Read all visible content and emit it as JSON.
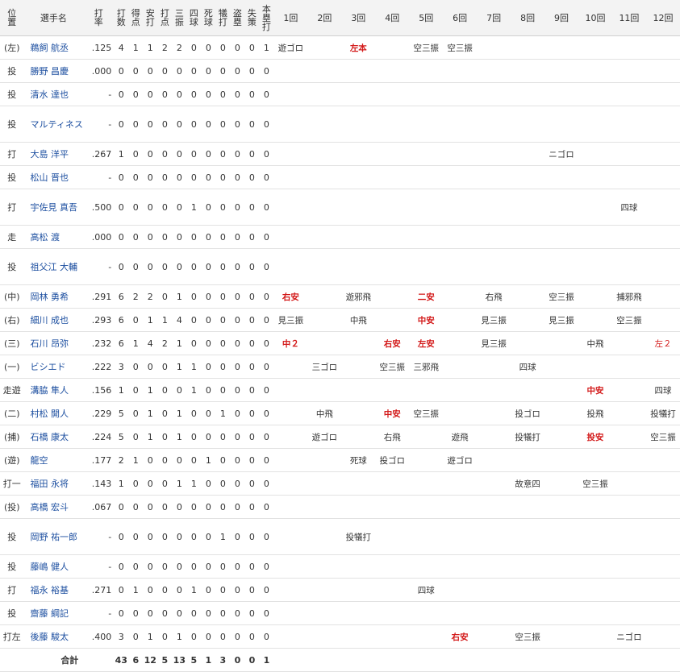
{
  "headers": {
    "pos": [
      "位",
      "置"
    ],
    "name": "選手名",
    "stats": [
      [
        "打",
        "率"
      ],
      [
        "打",
        "数"
      ],
      [
        "得",
        "点"
      ],
      [
        "安",
        "打"
      ],
      [
        "打",
        "点"
      ],
      [
        "三",
        "振"
      ],
      [
        "四",
        "球"
      ],
      [
        "死",
        "球"
      ],
      [
        "犠",
        "打"
      ],
      [
        "盗",
        "塁"
      ],
      [
        "失",
        "策"
      ],
      [
        "本",
        "塁",
        "打"
      ]
    ],
    "innings": [
      "1回",
      "2回",
      "3回",
      "4回",
      "5回",
      "6回",
      "7回",
      "8回",
      "9回",
      "10回",
      "11回",
      "12回"
    ]
  },
  "rows": [
    {
      "pos": "(左)",
      "name": "鵜飼 航丞",
      "avg": ".125",
      "s": [
        "4",
        "1",
        "1",
        "2",
        "2",
        "0",
        "0",
        "0",
        "0",
        "0",
        "1"
      ],
      "inn": [
        "遊ゴロ",
        "",
        "左本",
        "",
        "空三振",
        "空三振",
        "",
        "",
        "",
        "",
        "",
        ""
      ],
      "tall": false
    },
    {
      "pos": "投",
      "name": "勝野 昌慶",
      "avg": ".000",
      "s": [
        "0",
        "0",
        "0",
        "0",
        "0",
        "0",
        "0",
        "0",
        "0",
        "0",
        "0"
      ],
      "inn": [
        "",
        "",
        "",
        "",
        "",
        "",
        "",
        "",
        "",
        "",
        "",
        ""
      ],
      "tall": false
    },
    {
      "pos": "投",
      "name": "清水 達也",
      "avg": "-",
      "s": [
        "0",
        "0",
        "0",
        "0",
        "0",
        "0",
        "0",
        "0",
        "0",
        "0",
        "0"
      ],
      "inn": [
        "",
        "",
        "",
        "",
        "",
        "",
        "",
        "",
        "",
        "",
        "",
        ""
      ],
      "tall": false
    },
    {
      "pos": "投",
      "name": "マルティネス",
      "avg": "-",
      "s": [
        "0",
        "0",
        "0",
        "0",
        "0",
        "0",
        "0",
        "0",
        "0",
        "0",
        "0"
      ],
      "inn": [
        "",
        "",
        "",
        "",
        "",
        "",
        "",
        "",
        "",
        "",
        "",
        ""
      ],
      "tall": true
    },
    {
      "pos": "打",
      "name": "大島 洋平",
      "avg": ".267",
      "s": [
        "1",
        "0",
        "0",
        "0",
        "0",
        "0",
        "0",
        "0",
        "0",
        "0",
        "0"
      ],
      "inn": [
        "",
        "",
        "",
        "",
        "",
        "",
        "",
        "",
        "ニゴロ",
        "",
        "",
        ""
      ],
      "tall": false
    },
    {
      "pos": "投",
      "name": "松山 晋也",
      "avg": "-",
      "s": [
        "0",
        "0",
        "0",
        "0",
        "0",
        "0",
        "0",
        "0",
        "0",
        "0",
        "0"
      ],
      "inn": [
        "",
        "",
        "",
        "",
        "",
        "",
        "",
        "",
        "",
        "",
        "",
        ""
      ],
      "tall": false
    },
    {
      "pos": "打",
      "name": "宇佐見 真吾",
      "avg": ".500",
      "s": [
        "0",
        "0",
        "0",
        "0",
        "0",
        "1",
        "0",
        "0",
        "0",
        "0",
        "0"
      ],
      "inn": [
        "",
        "",
        "",
        "",
        "",
        "",
        "",
        "",
        "",
        "",
        "四球",
        ""
      ],
      "tall": true
    },
    {
      "pos": "走",
      "name": "高松 渡",
      "avg": ".000",
      "s": [
        "0",
        "0",
        "0",
        "0",
        "0",
        "0",
        "0",
        "0",
        "0",
        "0",
        "0"
      ],
      "inn": [
        "",
        "",
        "",
        "",
        "",
        "",
        "",
        "",
        "",
        "",
        "",
        ""
      ],
      "tall": false
    },
    {
      "pos": "投",
      "name": "祖父江 大輔",
      "avg": "-",
      "s": [
        "0",
        "0",
        "0",
        "0",
        "0",
        "0",
        "0",
        "0",
        "0",
        "0",
        "0"
      ],
      "inn": [
        "",
        "",
        "",
        "",
        "",
        "",
        "",
        "",
        "",
        "",
        "",
        ""
      ],
      "tall": true
    },
    {
      "pos": "(中)",
      "name": "岡林 勇希",
      "avg": ".291",
      "s": [
        "6",
        "2",
        "2",
        "0",
        "1",
        "0",
        "0",
        "0",
        "0",
        "0",
        "0"
      ],
      "inn": [
        "右安",
        "",
        "遊邪飛",
        "",
        "二安",
        "",
        "右飛",
        "",
        "空三振",
        "",
        "捕邪飛",
        ""
      ],
      "tall": false
    },
    {
      "pos": "(右)",
      "name": "細川 成也",
      "avg": ".293",
      "s": [
        "6",
        "0",
        "1",
        "1",
        "4",
        "0",
        "0",
        "0",
        "0",
        "0",
        "0"
      ],
      "inn": [
        "見三振",
        "",
        "中飛",
        "",
        "中安",
        "",
        "見三振",
        "",
        "見三振",
        "",
        "空三振",
        ""
      ],
      "tall": false
    },
    {
      "pos": "(三)",
      "name": "石川 昂弥",
      "avg": ".232",
      "s": [
        "6",
        "1",
        "4",
        "2",
        "1",
        "0",
        "0",
        "0",
        "0",
        "0",
        "0"
      ],
      "inn": [
        "中２",
        "",
        "",
        "右安",
        "左安",
        "",
        "見三振",
        "",
        "",
        "中飛",
        "",
        "左２"
      ],
      "tall": false
    },
    {
      "pos": "(一)",
      "name": "ビシエド",
      "avg": ".222",
      "s": [
        "3",
        "0",
        "0",
        "0",
        "1",
        "1",
        "0",
        "0",
        "0",
        "0",
        "0"
      ],
      "inn": [
        "",
        "三ゴロ",
        "",
        "空三振",
        "三邪飛",
        "",
        "",
        "四球",
        "",
        "",
        "",
        ""
      ],
      "tall": false
    },
    {
      "pos": "走遊",
      "name": "溝脇 隼人",
      "avg": ".156",
      "s": [
        "1",
        "0",
        "1",
        "0",
        "0",
        "1",
        "0",
        "0",
        "0",
        "0",
        "0"
      ],
      "inn": [
        "",
        "",
        "",
        "",
        "",
        "",
        "",
        "",
        "",
        "中安",
        "",
        "四球"
      ],
      "tall": false
    },
    {
      "pos": "(二)",
      "name": "村松 開人",
      "avg": ".229",
      "s": [
        "5",
        "0",
        "1",
        "0",
        "1",
        "0",
        "0",
        "1",
        "0",
        "0",
        "0"
      ],
      "inn": [
        "",
        "中飛",
        "",
        "中安",
        "空三振",
        "",
        "",
        "投ゴロ",
        "",
        "投飛",
        "",
        "投犠打"
      ],
      "tall": false
    },
    {
      "pos": "(捕)",
      "name": "石橋 康太",
      "avg": ".224",
      "s": [
        "5",
        "0",
        "1",
        "0",
        "1",
        "0",
        "0",
        "0",
        "0",
        "0",
        "0"
      ],
      "inn": [
        "",
        "遊ゴロ",
        "",
        "右飛",
        "",
        "遊飛",
        "",
        "投犠打",
        "",
        "投安",
        "",
        "空三振"
      ],
      "tall": false
    },
    {
      "pos": "(遊)",
      "name": "龍空",
      "avg": ".177",
      "s": [
        "2",
        "1",
        "0",
        "0",
        "0",
        "0",
        "1",
        "0",
        "0",
        "0",
        "0"
      ],
      "inn": [
        "",
        "",
        "死球",
        "投ゴロ",
        "",
        "遊ゴロ",
        "",
        "",
        "",
        "",
        "",
        ""
      ],
      "tall": false
    },
    {
      "pos": "打一",
      "name": "福田 永将",
      "avg": ".143",
      "s": [
        "1",
        "0",
        "0",
        "0",
        "1",
        "1",
        "0",
        "0",
        "0",
        "0",
        "0"
      ],
      "inn": [
        "",
        "",
        "",
        "",
        "",
        "",
        "",
        "故意四",
        "",
        "空三振",
        "",
        ""
      ],
      "tall": false
    },
    {
      "pos": "(投)",
      "name": "高橋 宏斗",
      "avg": ".067",
      "s": [
        "0",
        "0",
        "0",
        "0",
        "0",
        "0",
        "0",
        "0",
        "0",
        "0",
        "0"
      ],
      "inn": [
        "",
        "",
        "",
        "",
        "",
        "",
        "",
        "",
        "",
        "",
        "",
        ""
      ],
      "tall": false
    },
    {
      "pos": "投",
      "name": "岡野 祐一郎",
      "avg": "-",
      "s": [
        "0",
        "0",
        "0",
        "0",
        "0",
        "0",
        "0",
        "1",
        "0",
        "0",
        "0"
      ],
      "inn": [
        "",
        "",
        "投犠打",
        "",
        "",
        "",
        "",
        "",
        "",
        "",
        "",
        ""
      ],
      "tall": true
    },
    {
      "pos": "投",
      "name": "藤嶋 健人",
      "avg": "-",
      "s": [
        "0",
        "0",
        "0",
        "0",
        "0",
        "0",
        "0",
        "0",
        "0",
        "0",
        "0"
      ],
      "inn": [
        "",
        "",
        "",
        "",
        "",
        "",
        "",
        "",
        "",
        "",
        "",
        ""
      ],
      "tall": false
    },
    {
      "pos": "打",
      "name": "福永 裕基",
      "avg": ".271",
      "s": [
        "0",
        "1",
        "0",
        "0",
        "0",
        "1",
        "0",
        "0",
        "0",
        "0",
        "0"
      ],
      "inn": [
        "",
        "",
        "",
        "",
        "四球",
        "",
        "",
        "",
        "",
        "",
        "",
        ""
      ],
      "tall": false
    },
    {
      "pos": "投",
      "name": "齋藤 綱記",
      "avg": "-",
      "s": [
        "0",
        "0",
        "0",
        "0",
        "0",
        "0",
        "0",
        "0",
        "0",
        "0",
        "0"
      ],
      "inn": [
        "",
        "",
        "",
        "",
        "",
        "",
        "",
        "",
        "",
        "",
        "",
        ""
      ],
      "tall": false
    },
    {
      "pos": "打左",
      "name": "後藤 駿太",
      "avg": ".400",
      "s": [
        "3",
        "0",
        "1",
        "0",
        "1",
        "0",
        "0",
        "0",
        "0",
        "0",
        "0"
      ],
      "inn": [
        "",
        "",
        "",
        "",
        "",
        "右安",
        "",
        "空三振",
        "",
        "",
        "ニゴロ",
        ""
      ],
      "tall": false
    }
  ],
  "total": {
    "label": "合計",
    "s": [
      "43",
      "6",
      "12",
      "5",
      "13",
      "5",
      "1",
      "3",
      "0",
      "0",
      "1"
    ]
  },
  "hits": [
    "左本",
    "右安",
    "二安",
    "中安",
    "中２",
    "左安",
    "左２",
    "投安"
  ]
}
